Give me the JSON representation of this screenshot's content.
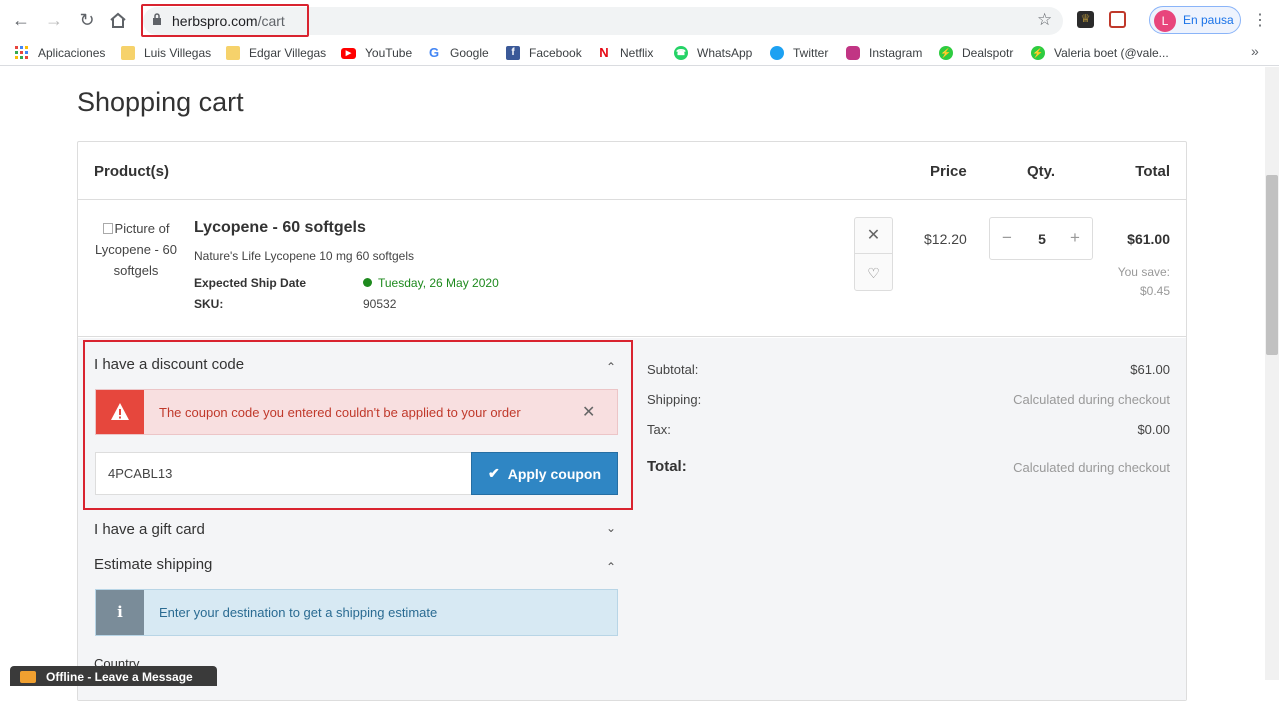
{
  "browser": {
    "url_domain": "herbspro.com",
    "url_path": "/cart",
    "profile_initial": "L",
    "profile_status": "En pausa"
  },
  "bookmarks": [
    {
      "label": "Aplicaciones",
      "icon": "apps-grid-icon",
      "color": "#e8453c"
    },
    {
      "label": "Luis Villegas",
      "icon": "folder-icon",
      "color": "#f6d26b"
    },
    {
      "label": "Edgar Villegas",
      "icon": "folder-icon",
      "color": "#f6d26b"
    },
    {
      "label": "YouTube",
      "icon": "youtube-icon",
      "color": "#ff0000"
    },
    {
      "label": "Google",
      "icon": "google-icon",
      "color": "#4285f4"
    },
    {
      "label": "Facebook",
      "icon": "facebook-icon",
      "color": "#3b5998"
    },
    {
      "label": "Netflix",
      "icon": "netflix-icon",
      "color": "#e50914"
    },
    {
      "label": "WhatsApp",
      "icon": "whatsapp-icon",
      "color": "#25d366"
    },
    {
      "label": "Twitter",
      "icon": "twitter-icon",
      "color": "#1da1f2"
    },
    {
      "label": "Instagram",
      "icon": "instagram-icon",
      "color": "#c13584"
    },
    {
      "label": "Dealspotr",
      "icon": "bolt-icon",
      "color": "#2ecc40"
    },
    {
      "label": "Valeria boet (@vale...",
      "icon": "bolt-icon",
      "color": "#2ecc40"
    }
  ],
  "page": {
    "title": "Shopping cart"
  },
  "cart": {
    "headers": {
      "product": "Product(s)",
      "price": "Price",
      "qty": "Qty.",
      "total": "Total"
    },
    "item": {
      "image_alt": "Picture of Lycopene - 60 softgels",
      "name": "Lycopene - 60 softgels",
      "description": "Nature's Life Lycopene 10 mg 60 softgels",
      "ship_label": "Expected Ship Date",
      "ship_date": "Tuesday, 26 May 2020",
      "sku_label": "SKU:",
      "sku": "90532",
      "price": "$12.20",
      "quantity": "5",
      "total": "$61.00",
      "save_label": "You save:",
      "save_amount": "$0.45"
    }
  },
  "discount": {
    "title": "I have a discount code",
    "error": "The coupon code you entered couldn't be applied to your order",
    "code": "4PCABL13",
    "apply_label": "Apply coupon"
  },
  "gift_card": {
    "title": "I have a gift card"
  },
  "estimate": {
    "title": "Estimate shipping",
    "info": "Enter your destination to get a shipping estimate",
    "country_label": "Country"
  },
  "summary": {
    "subtotal_label": "Subtotal:",
    "subtotal": "$61.00",
    "shipping_label": "Shipping:",
    "shipping": "Calculated during checkout",
    "tax_label": "Tax:",
    "tax": "$0.00",
    "total_label": "Total:",
    "total": "Calculated during checkout"
  },
  "chat": {
    "label": "Offline - Leave a Message"
  }
}
